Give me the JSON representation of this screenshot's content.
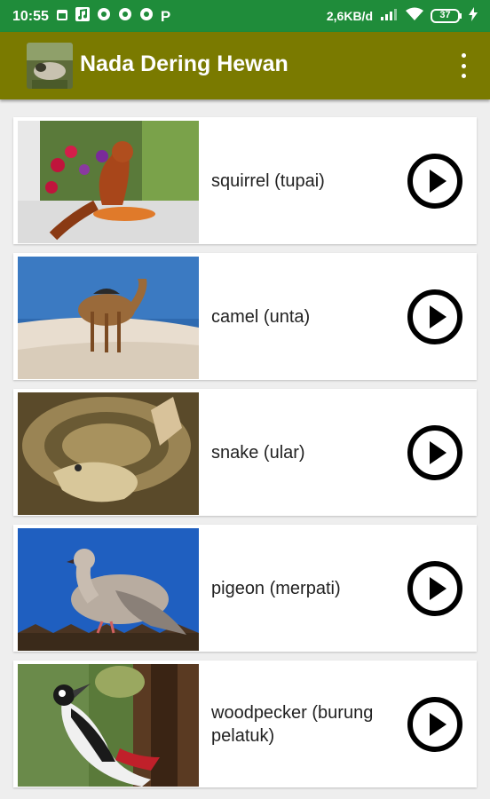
{
  "status_bar": {
    "time": "10:55",
    "net_speed": "2,6KB/d",
    "battery": "37",
    "left_icons": [
      "calendar-icon",
      "music-icon",
      "chrome-icon",
      "chrome-icon",
      "chrome-icon",
      "p-icon"
    ],
    "right_icons": [
      "signal-icon",
      "wifi-icon",
      "battery-icon",
      "charging-icon"
    ],
    "p_glyph": "P"
  },
  "app_bar": {
    "title": "Nada Dering Hewan",
    "menu_icon": "more-vert-icon"
  },
  "animals": [
    {
      "label": "squirrel (tupai)"
    },
    {
      "label": "camel (unta)"
    },
    {
      "label": "snake (ular)"
    },
    {
      "label": "pigeon (merpati)"
    },
    {
      "label": "woodpecker (burung pelatuk)"
    }
  ],
  "colors": {
    "status_bar": "#1f8c3a",
    "app_bar": "#7a7a00",
    "background": "#eeeeee",
    "card": "#ffffff",
    "play_button": "#000000"
  }
}
